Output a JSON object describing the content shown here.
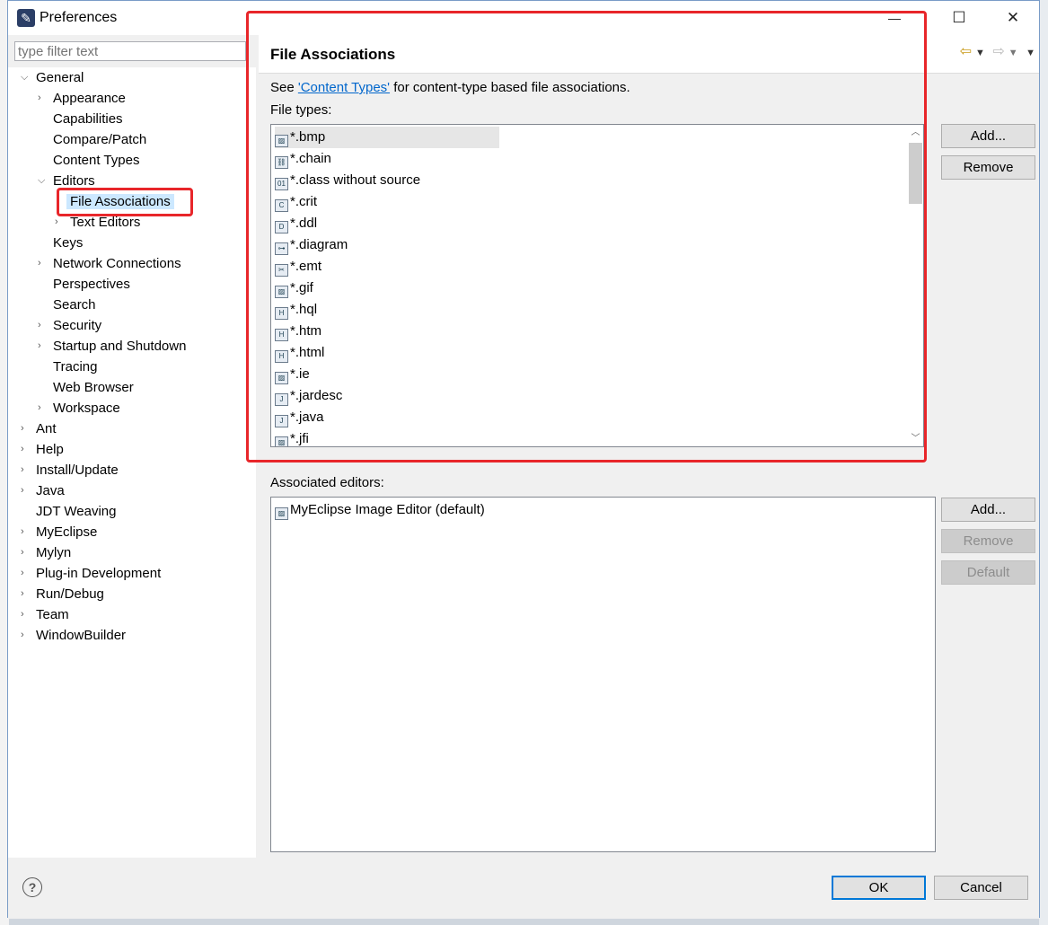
{
  "window": {
    "title": "Preferences",
    "minimize": "—",
    "maximize": "☐",
    "close": "✕"
  },
  "filter": {
    "placeholder": "type filter text"
  },
  "tree": {
    "general": "General",
    "general_children": [
      "Appearance",
      "Capabilities",
      "Compare/Patch",
      "Content Types",
      "Editors"
    ],
    "editors_children": [
      "File Associations",
      "Text Editors"
    ],
    "general_rest": [
      "Keys",
      "Network Connections",
      "Perspectives",
      "Search",
      "Security",
      "Startup and Shutdown",
      "Tracing",
      "Web Browser",
      "Workspace"
    ],
    "top_level": [
      "Ant",
      "Help",
      "Install/Update",
      "Java",
      "JDT Weaving",
      "MyEclipse",
      "Mylyn",
      "Plug-in Development",
      "Run/Debug",
      "Team",
      "WindowBuilder"
    ]
  },
  "page": {
    "title": "File Associations",
    "see_prefix": "See ",
    "see_link": "'Content Types'",
    "see_suffix": " for content-type based file associations.",
    "file_types_label": "File types:",
    "file_types": [
      "*.bmp",
      "*.chain",
      "*.class without source",
      "*.crit",
      "*.ddl",
      "*.diagram",
      "*.emt",
      "*.gif",
      "*.hql",
      "*.htm",
      "*.html",
      "*.ie",
      "*.jardesc",
      "*.java",
      "*.jfi"
    ],
    "file_type_icons": [
      "image-icon",
      "chain-icon",
      "class-icon",
      "crit-icon",
      "ddl-icon",
      "diagram-icon",
      "emt-icon",
      "image-icon",
      "hql-icon",
      "html-icon",
      "html-icon",
      "image-icon",
      "jardesc-icon",
      "java-icon",
      "image-icon"
    ],
    "add_label": "Add...",
    "remove_label": "Remove",
    "associated_label": "Associated editors:",
    "associated_editors": [
      "MyEclipse Image Editor (default)"
    ],
    "default_label": "Default"
  },
  "footer": {
    "help": "?",
    "ok": "OK",
    "cancel": "Cancel"
  },
  "colors": {
    "annotation": "#e8262a",
    "link": "#0066cc",
    "selection": "#cce8ff"
  }
}
